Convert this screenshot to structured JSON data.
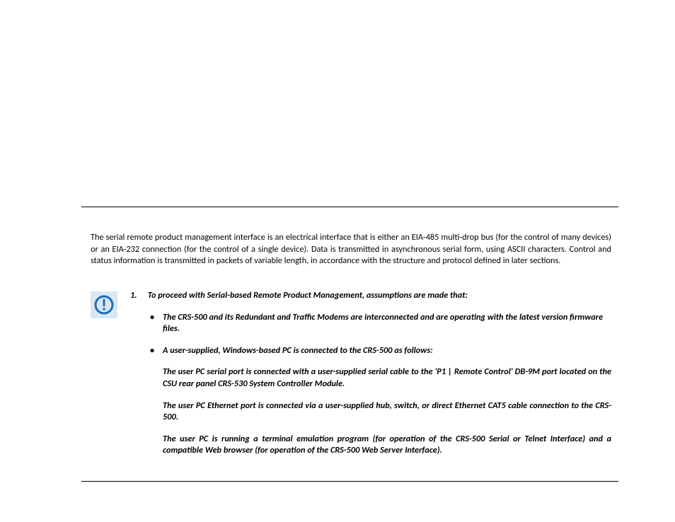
{
  "intro": "The serial remote product management interface is an electrical interface that is either an EIA-485 multi-drop bus (for the control of many devices) or an EIA-232 connection (for the control of a single device). Data is transmitted in asynchronous serial form, using ASCII characters. Control and status information is transmitted in packets of variable length, in accordance with the structure and protocol defined in later sections.",
  "note": {
    "icon": "info-icon",
    "number": "1.",
    "lead": "To proceed with Serial-based Remote Product Management, assumptions are made that:",
    "bullets": [
      "The CRS-500 and its Redundant and Traffic Modems are interconnected and are operating with the latest version firmware files.",
      "A user-supplied, Windows-based PC is connected to the CRS-500 as follows:"
    ],
    "sub": [
      "The user PC serial port is connected with a user-supplied serial cable to the 'P1 | Remote Control' DB-9M port located on the CSU rear panel CRS-530 System Controller Module.",
      "The user PC Ethernet port is connected via a user-supplied hub, switch, or direct Ethernet CAT5 cable connection to the CRS-500.",
      "The user PC is running a terminal emulation program (for operation of the CRS-500 Serial or Telnet Interface) and a compatible Web browser (for operation of the CRS-500 Web Server Interface)."
    ]
  }
}
